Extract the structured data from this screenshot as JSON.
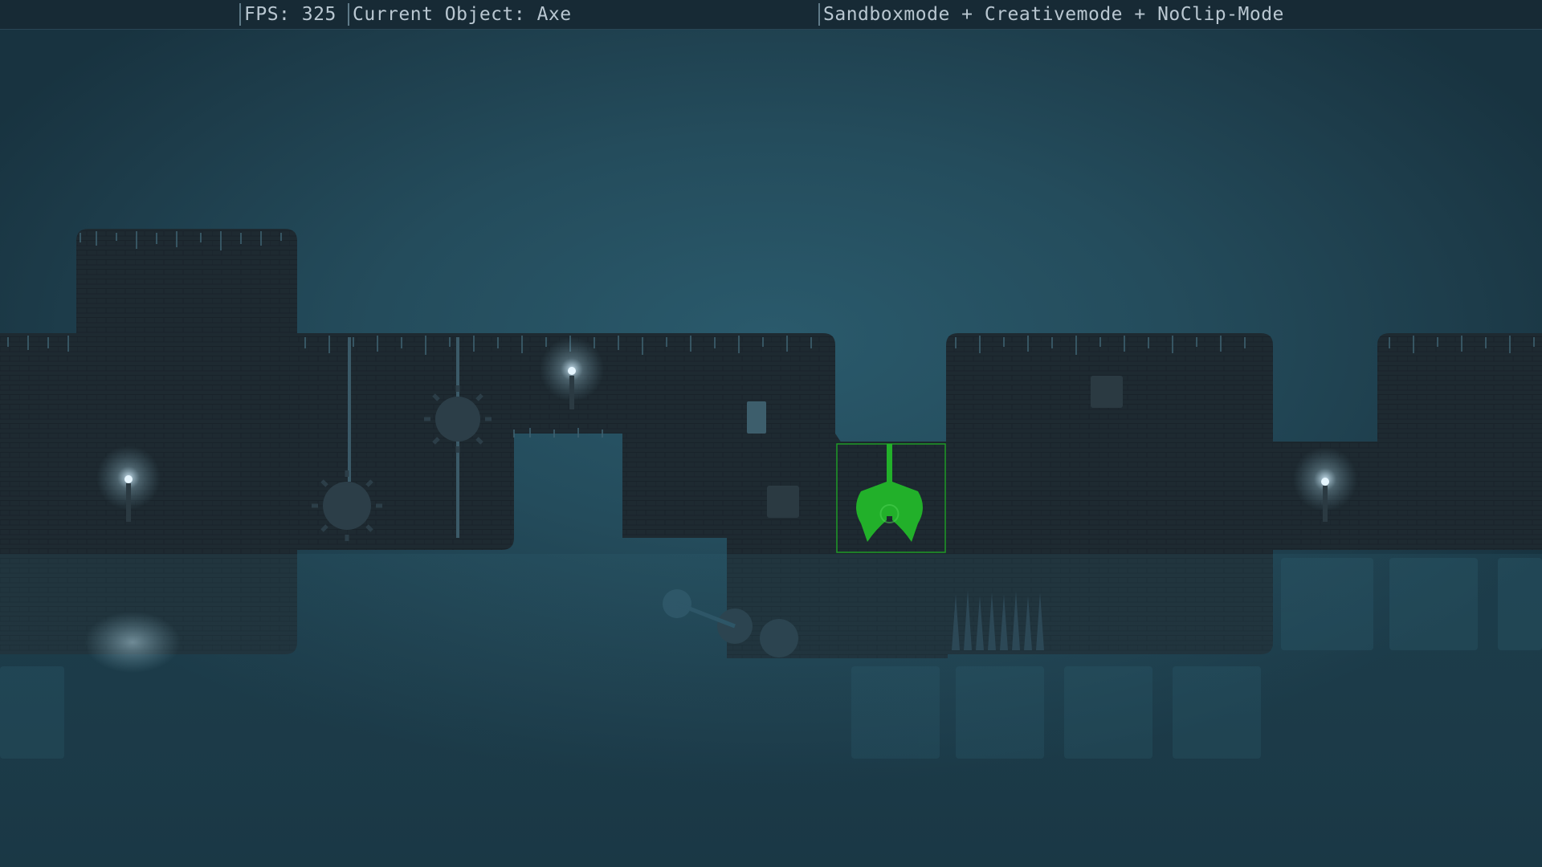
{
  "hud": {
    "fps_label": "FPS:",
    "fps_value": "325",
    "current_object_label": "Current Object:",
    "current_object_value": "Axe",
    "mode_text": "Sandboxmode + Creativemode + NoClip-Mode"
  },
  "scene": {
    "selected_object_icon": "axe-icon",
    "colors": {
      "hud_background": "#172a35",
      "hud_text": "#b9c7d1",
      "sky": "#2a5a6c",
      "fog": "#2f6173",
      "terrain": "#1e2a31",
      "selection": "#22b02a"
    }
  }
}
